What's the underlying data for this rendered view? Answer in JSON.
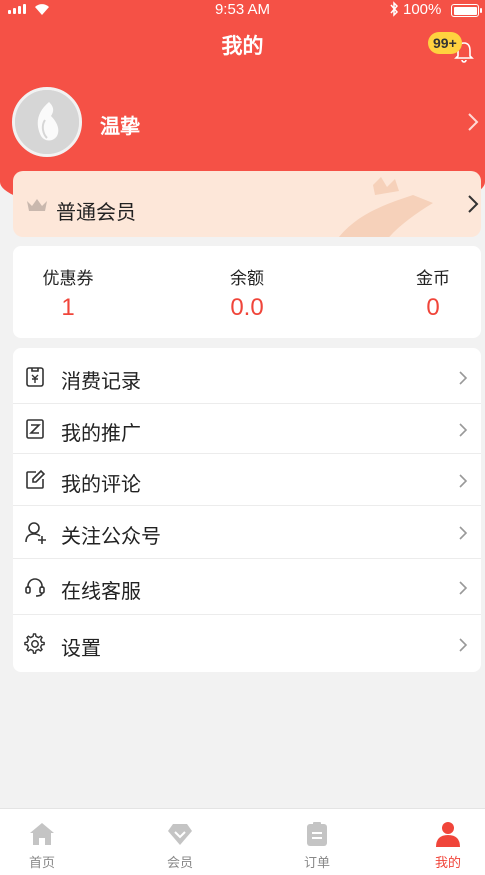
{
  "status_bar": {
    "time": "9:53 AM",
    "battery": "100%"
  },
  "header": {
    "title": "我的",
    "notification_badge": "99+"
  },
  "profile": {
    "username": "温挚"
  },
  "membership": {
    "label": "普通会员"
  },
  "stats": [
    {
      "label": "优惠券",
      "value": "1"
    },
    {
      "label": "余额",
      "value": "0.0"
    },
    {
      "label": "金币",
      "value": "0"
    }
  ],
  "menu": [
    {
      "label": "消费记录",
      "icon": "receipt-icon"
    },
    {
      "label": "我的推广",
      "icon": "promotion-icon"
    },
    {
      "label": "我的评论",
      "icon": "edit-icon"
    },
    {
      "label": "关注公众号",
      "icon": "user-add-icon"
    },
    {
      "label": "在线客服",
      "icon": "headset-icon"
    },
    {
      "label": "设置",
      "icon": "gear-icon"
    }
  ],
  "tabs": [
    {
      "label": "首页",
      "icon": "home-icon",
      "active": false
    },
    {
      "label": "会员",
      "icon": "diamond-icon",
      "active": false
    },
    {
      "label": "订单",
      "icon": "clipboard-icon",
      "active": false
    },
    {
      "label": "我的",
      "icon": "person-icon",
      "active": true
    }
  ],
  "colors": {
    "brand_red": "#f55146",
    "accent_red": "#f0453a",
    "badge_yellow": "#ffd23f",
    "member_card_bg": "#fde7d9",
    "page_bg": "#f2f2f2"
  }
}
